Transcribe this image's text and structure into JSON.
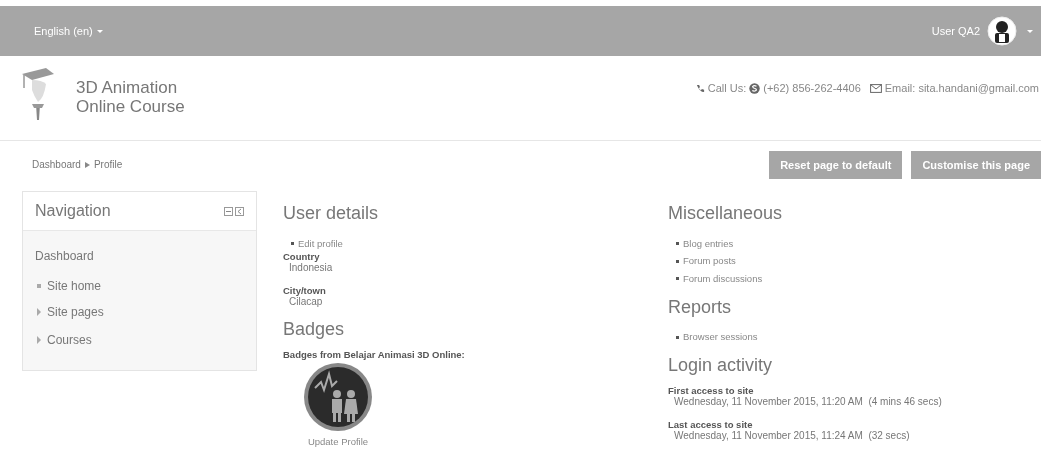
{
  "top_bar": {
    "language": "English (en)",
    "user": "User QA2"
  },
  "header": {
    "site_name_lines": [
      "3D Animation",
      "Online Course"
    ],
    "call_label": "Call Us:",
    "phone": "(+62) 856-262-4406",
    "email": "Email: sita.handani@gmail.com"
  },
  "breadcrumb": [
    "Dashboard",
    "Profile"
  ],
  "buttons": [
    "Reset page to default",
    "Customise this page"
  ],
  "navigation": {
    "title": "Navigation",
    "items": [
      {
        "label": "Dashboard",
        "kind": "root"
      },
      {
        "label": "Site home",
        "kind": "leaf"
      },
      {
        "label": "Site pages",
        "kind": "branch"
      },
      {
        "label": "Courses",
        "kind": "branch"
      }
    ]
  },
  "columns": [
    [
      {
        "title": "User details",
        "items": [
          {
            "kind": "link",
            "text": "Edit profile"
          },
          {
            "kind": "field",
            "label": "Country",
            "value": "Indonesia"
          },
          {
            "kind": "field",
            "label": "City/town",
            "value": "Cilacap"
          }
        ]
      },
      {
        "title": "Badges",
        "items": [
          {
            "kind": "badges",
            "label": "Badges from Belajar Animasi 3D Online:",
            "badges": [
              "Update Profile"
            ]
          }
        ]
      }
    ],
    [
      {
        "title": "Miscellaneous",
        "items": [
          {
            "kind": "link",
            "text": "Blog entries"
          },
          {
            "kind": "link",
            "text": "Forum posts"
          },
          {
            "kind": "link",
            "text": "Forum discussions"
          }
        ]
      },
      {
        "title": "Reports",
        "items": [
          {
            "kind": "link",
            "text": "Browser sessions"
          }
        ]
      },
      {
        "title": "Login activity",
        "items": [
          {
            "kind": "field",
            "label": "First access to site",
            "value": "Wednesday, 11 November 2015, 11:20 AM  (4 mins 46 secs)"
          },
          {
            "kind": "field",
            "label": "Last access to site",
            "value": "Wednesday, 11 November 2015, 11:24 AM  (32 secs)"
          }
        ]
      }
    ]
  ]
}
